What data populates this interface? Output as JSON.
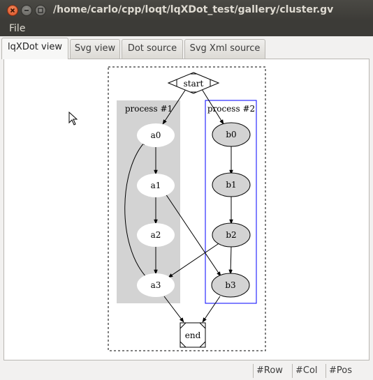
{
  "window": {
    "title": "/home/carlo/cpp/loqt/lqXDot_test/gallery/cluster.gv"
  },
  "menu": {
    "file": "File"
  },
  "tabs": [
    {
      "label": "lqXDot view",
      "active": true
    },
    {
      "label": "Svg view",
      "active": false
    },
    {
      "label": "Dot source",
      "active": false
    },
    {
      "label": "Svg Xml source",
      "active": false
    }
  ],
  "graph": {
    "clusters": [
      {
        "label": "process #1",
        "fill": "#d3d3d3"
      },
      {
        "label": "process #2",
        "stroke": "#0000ff"
      }
    ],
    "nodes": {
      "start": "start",
      "end": "end",
      "a0": "a0",
      "a1": "a1",
      "a2": "a2",
      "a3": "a3",
      "b0": "b0",
      "b1": "b1",
      "b2": "b2",
      "b3": "b3"
    },
    "edges": [
      [
        "start",
        "a0"
      ],
      [
        "start",
        "b0"
      ],
      [
        "a0",
        "a1"
      ],
      [
        "a1",
        "a2"
      ],
      [
        "a2",
        "a3"
      ],
      [
        "a3",
        "a0"
      ],
      [
        "a1",
        "b3"
      ],
      [
        "b0",
        "b1"
      ],
      [
        "b1",
        "b2"
      ],
      [
        "b2",
        "b3"
      ],
      [
        "b2",
        "a3"
      ],
      [
        "a3",
        "end"
      ],
      [
        "b3",
        "end"
      ]
    ]
  },
  "status": {
    "row": "#Row",
    "col": "#Col",
    "pos": "#Pos"
  }
}
